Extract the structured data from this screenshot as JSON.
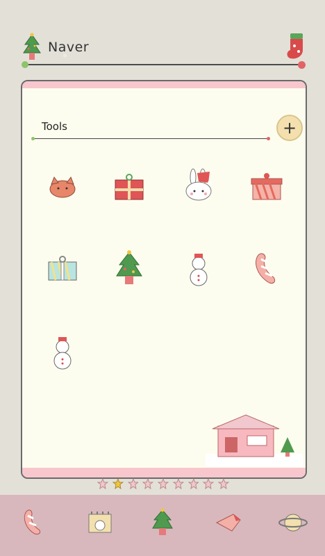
{
  "search": {
    "brand": "Naver"
  },
  "folder": {
    "title": "Tools"
  },
  "pager": {
    "count": 9,
    "active": 1
  },
  "apps": [
    {
      "name": "cat-face-icon"
    },
    {
      "name": "red-gift-icon"
    },
    {
      "name": "bunny-santa-hat-icon"
    },
    {
      "name": "striped-gift-icon"
    },
    {
      "name": "blue-gift-icon"
    },
    {
      "name": "christmas-tree-icon"
    },
    {
      "name": "snowman-icon"
    },
    {
      "name": "candy-phone-icon"
    },
    {
      "name": "snowman-icon"
    }
  ],
  "dock": [
    {
      "name": "phone-icon"
    },
    {
      "name": "contacts-calendar-icon"
    },
    {
      "name": "christmas-tree-icon"
    },
    {
      "name": "message-bird-icon"
    },
    {
      "name": "planet-icon"
    }
  ]
}
